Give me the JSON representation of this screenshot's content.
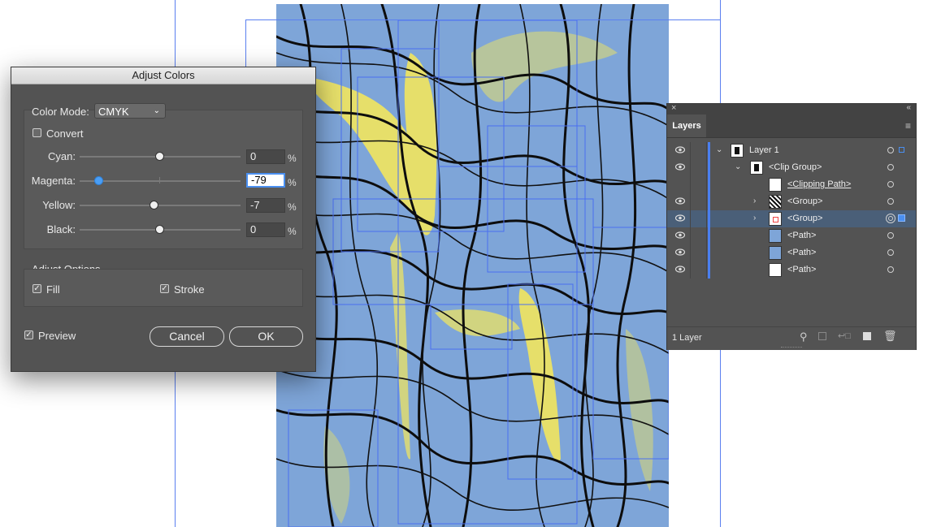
{
  "dialog": {
    "title": "Adjust Colors",
    "color_mode_label": "Color Mode:",
    "color_mode_value": "CMYK",
    "convert_label": "Convert",
    "convert_checked": false,
    "sliders": [
      {
        "label": "Cyan:",
        "value": "0",
        "unit": "%"
      },
      {
        "label": "Magenta:",
        "value": "-79",
        "unit": "%"
      },
      {
        "label": "Yellow:",
        "value": "-7",
        "unit": "%"
      },
      {
        "label": "Black:",
        "value": "0",
        "unit": "%"
      }
    ],
    "adjust_options_label": "Adjust Options",
    "fill_label": "Fill",
    "fill_checked": true,
    "stroke_label": "Stroke",
    "stroke_checked": true,
    "preview_label": "Preview",
    "preview_checked": true,
    "cancel_label": "Cancel",
    "ok_label": "OK"
  },
  "layers_panel": {
    "tab_label": "Layers",
    "rows": [
      {
        "name": "Layer 1"
      },
      {
        "name": "<Clip Group>"
      },
      {
        "name": "<Clipping Path>"
      },
      {
        "name": "<Group>"
      },
      {
        "name": "<Group>"
      },
      {
        "name": "<Path>"
      },
      {
        "name": "<Path>"
      },
      {
        "name": "<Path>"
      }
    ],
    "footer_count": "1 Layer"
  },
  "colors": {
    "artboard_bg": "#7ea5d8",
    "accent_yellow": "#f5e85a",
    "selection_blue": "#4a7ff0",
    "dialog_bg": "#535353"
  }
}
